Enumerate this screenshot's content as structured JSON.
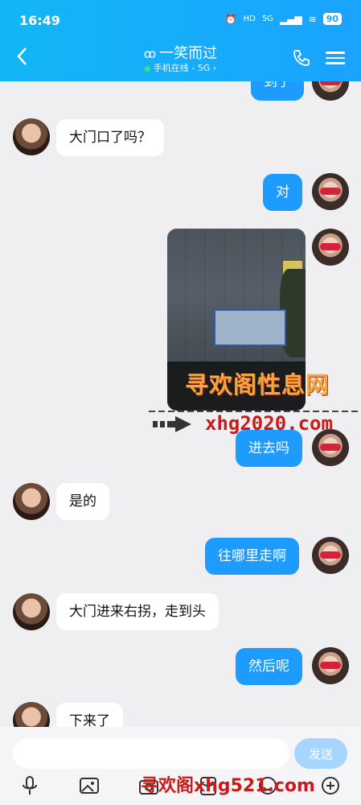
{
  "status_bar": {
    "time": "16:49",
    "battery": "90",
    "network": "5G",
    "hd": "HD"
  },
  "header": {
    "title": "一笑而过",
    "subtitle": "手机在线 - 5G ›"
  },
  "messages": [
    {
      "side": "right",
      "text": "到了"
    },
    {
      "side": "left",
      "text": "大门口了吗？"
    },
    {
      "side": "right",
      "text": "对"
    },
    {
      "side": "right",
      "type": "image",
      "image_text": "寻欢阁性息网"
    },
    {
      "side": "right",
      "text": "进去吗"
    },
    {
      "side": "left",
      "text": "是的"
    },
    {
      "side": "right",
      "text": "往哪里走啊"
    },
    {
      "side": "left",
      "text": "大门进来右拐，走到头"
    },
    {
      "side": "right",
      "text": "然后呢"
    },
    {
      "side": "left",
      "text": "下来了"
    }
  ],
  "watermarks": {
    "image_overlay": "寻欢阁性息网",
    "url1": "xhg2020.com",
    "url2": "寻欢阁xhg521.com"
  },
  "input": {
    "placeholder": "",
    "send_label": "发送"
  },
  "toolbar": [
    "microphone-icon",
    "image-icon",
    "camera-icon",
    "red-packet-icon",
    "emoji-icon",
    "plus-icon"
  ],
  "colors": {
    "header": "#1aa3ff",
    "bubble_right": "#1e9bff",
    "send_disabled": "#a6d6ff"
  }
}
